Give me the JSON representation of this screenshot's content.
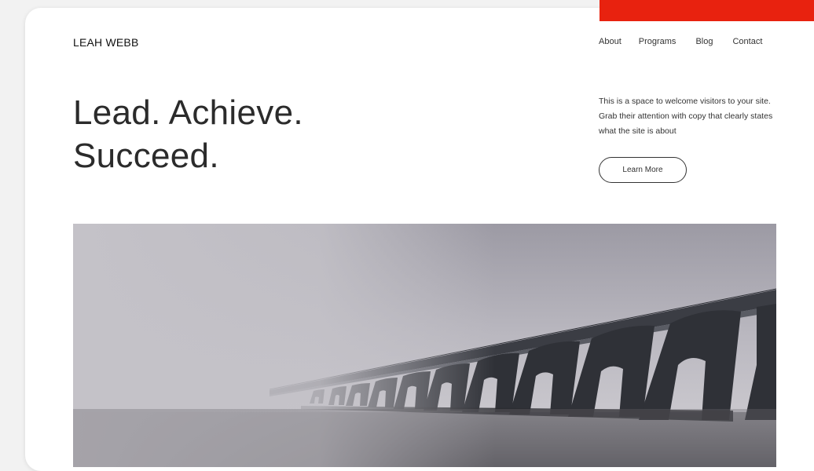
{
  "header": {
    "brand": "LEAH WEBB",
    "nav": [
      "About",
      "Programs",
      "Blog",
      "Contact"
    ]
  },
  "hero": {
    "headline_line1": "Lead. Achieve.",
    "headline_line2": "Succeed.",
    "blurb": "This is a space to welcome visitors to your site. Grab their attention with copy that clearly states what the site is about",
    "cta_label": "Learn More"
  },
  "colors": {
    "accent": "#e8220f",
    "text": "#2b2b2b",
    "card_bg": "#ffffff",
    "page_bg": "#f2f2f2"
  }
}
